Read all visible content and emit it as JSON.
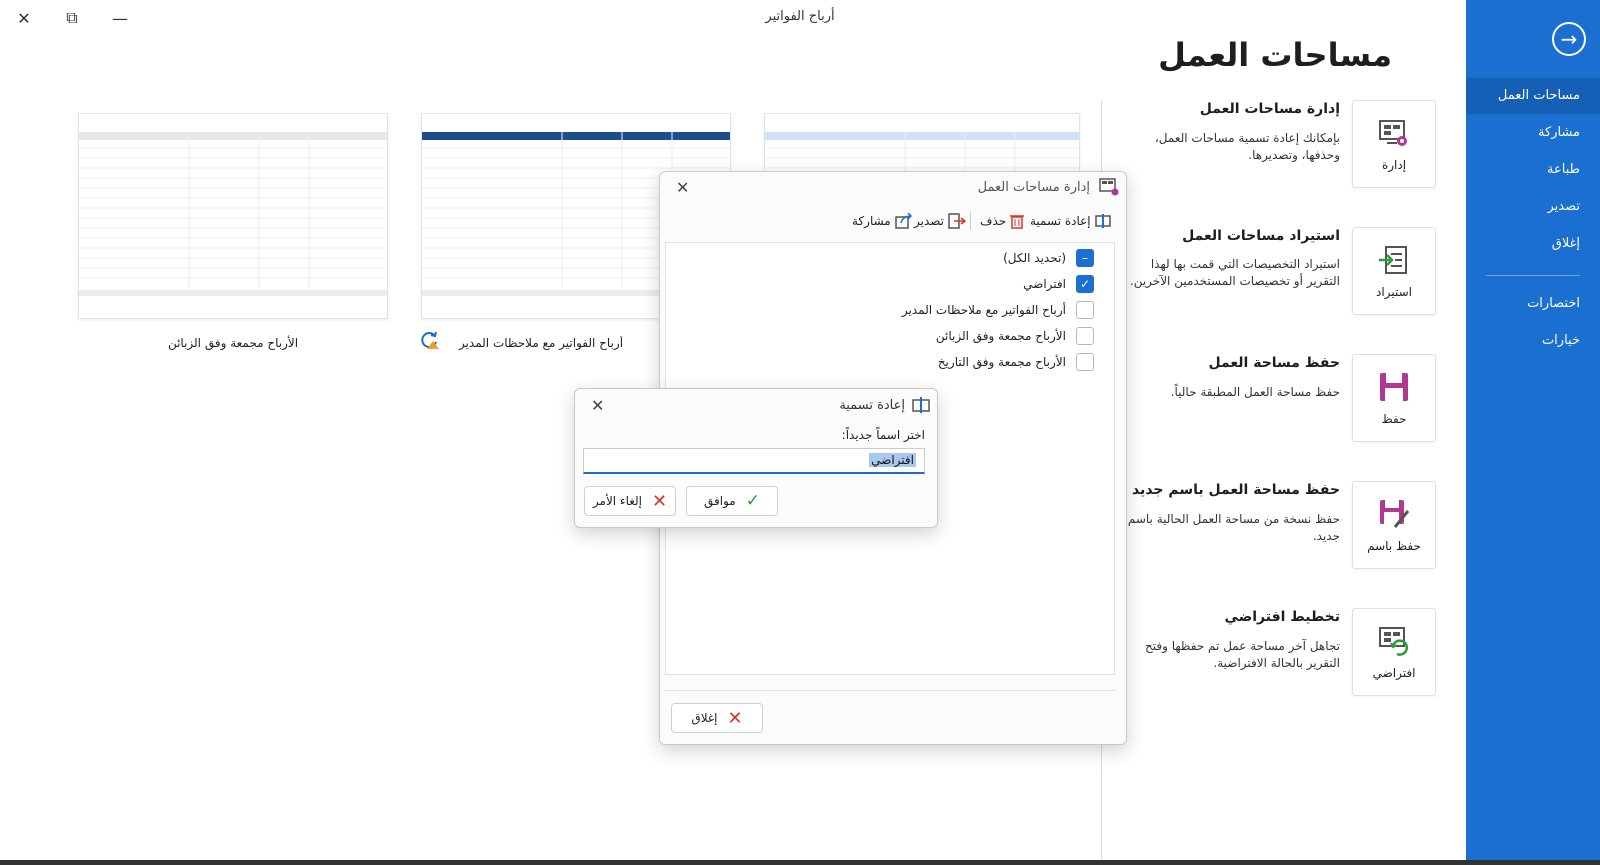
{
  "window": {
    "title": "أرباح الفواتير",
    "close_glyph": "✕",
    "restore_glyph": "⧉",
    "minimize_glyph": "—"
  },
  "sidenav": {
    "back_glyph": "→",
    "items": [
      {
        "label": "مساحات العمل",
        "active": true
      },
      {
        "label": "مشاركة"
      },
      {
        "label": "طباعة"
      },
      {
        "label": "تصدير"
      },
      {
        "label": "إغلاق"
      },
      {
        "label": "اختصارات"
      },
      {
        "label": "خيارات"
      }
    ]
  },
  "page": {
    "title": "مساحات العمل"
  },
  "actions": [
    {
      "tile_label": "إدارة",
      "icon": "manage-workspace-icon",
      "title": "إدارة مساحات العمل",
      "desc": "بإمكانك إعادة تسمية مساحات العمل، وحذفها، وتصديرها."
    },
    {
      "tile_label": "استيراد",
      "icon": "import-icon",
      "title": "استيراد مساحات العمل",
      "desc": "استيراد التخصيصات التي قمت بها لهذا التقرير أو تخصيصات المستخدمين الآخرين."
    },
    {
      "tile_label": "حفظ",
      "icon": "save-icon",
      "title": "حفظ مساحة العمل",
      "desc": "حفظ مساحة العمل المطبقة حالياً."
    },
    {
      "tile_label": "حفظ باسم",
      "icon": "save-as-icon",
      "title": "حفظ مساحة العمل باسم جديد",
      "desc": "حفظ نسخة من مساحة العمل الحالية باسم جديد."
    },
    {
      "tile_label": "افتراضي",
      "icon": "default-layout-icon",
      "title": "تخطيط افتراضي",
      "desc": "تجاهل آخر مساحة عمل تم حفظها وفتح التقرير بالحالة الافتراضية."
    }
  ],
  "thumbnails": [
    {
      "caption": "الأرباح مجمعة وفق الزبائن"
    },
    {
      "caption": "أرباح الفواتير مع ملاحظات المدير"
    },
    {
      "caption": ""
    }
  ],
  "manage_dialog": {
    "title": "إدارة مساحات العمل",
    "close_glyph": "✕",
    "toolbar": {
      "rename": "إعادة تسمية",
      "delete": "حذف",
      "export": "تصدير",
      "share": "مشاركة"
    },
    "items": [
      {
        "label": "(تحديد الكل)",
        "state": "indeterminate"
      },
      {
        "label": "افتراضي",
        "state": "checked"
      },
      {
        "label": "أرباح الفواتير مع ملاحظات المدير",
        "state": "unchecked"
      },
      {
        "label": "الأرباح مجمعة وفق الزبائن",
        "state": "unchecked"
      },
      {
        "label": "الأرباح مجمعة وفق التاريخ",
        "state": "unchecked"
      }
    ],
    "close_button": "إغلاق"
  },
  "rename_dialog": {
    "title": "إعادة تسمية",
    "close_glyph": "✕",
    "prompt": "اختر اسماً جديداً:",
    "value": "افتراضي",
    "ok": "موافق",
    "cancel": "إلغاء الأمر"
  },
  "colors": {
    "accent": "#1a6fd1",
    "danger": "#d9342b",
    "success": "#2c9c3a",
    "icon_purple": "#b0388f"
  }
}
